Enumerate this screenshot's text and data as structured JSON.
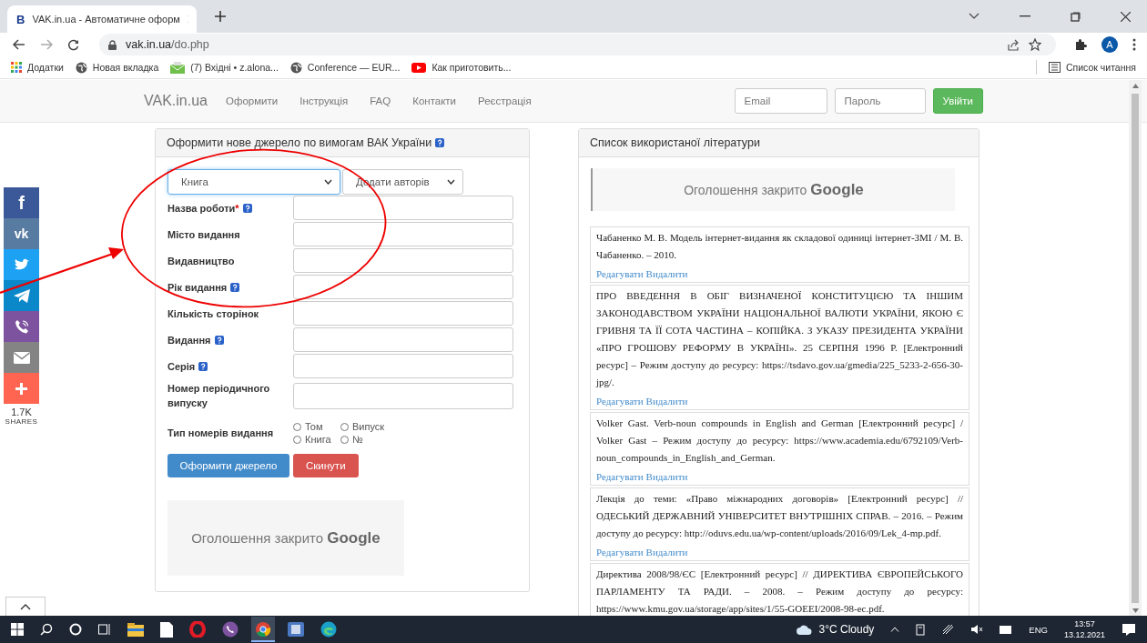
{
  "browser": {
    "tab_title": "VAK.in.ua - Автоматичне оформ",
    "tab_favicon": "B",
    "url_host": "vak.in.ua",
    "url_path": "/do.php",
    "avatar": "A",
    "bookmarks": [
      {
        "kind": "apps",
        "label": "Додатки"
      },
      {
        "kind": "globe",
        "label": "Новая вкладка"
      },
      {
        "kind": "mail",
        "label": "(7) Вхідні • z.alona..."
      },
      {
        "kind": "globe",
        "label": "Conference — EUR..."
      },
      {
        "kind": "youtube",
        "label": "Как приготовить..."
      }
    ],
    "reading_list": "Список читання"
  },
  "nav": {
    "brand": "VAK.in.ua",
    "links": [
      "Оформити",
      "Інструкція",
      "FAQ",
      "Контакти",
      "Реєстрація"
    ],
    "email_placeholder": "Email",
    "password_placeholder": "Пароль",
    "login": "Увійти"
  },
  "form": {
    "title": "Оформити нове джерело по вимогам ВАК України",
    "type_select": "Книга",
    "authors_select": "Додати авторів",
    "fields": [
      {
        "label": "Назва роботи",
        "required_mark": "*",
        "help": true
      },
      {
        "label": "Місто видання",
        "help": false
      },
      {
        "label": "Видавництво",
        "help": false
      },
      {
        "label": "Рік видання",
        "help": true
      },
      {
        "label": "Кількість сторінок",
        "help": false
      },
      {
        "label": "Видання",
        "help": true
      },
      {
        "label": "Серія",
        "help": true
      },
      {
        "label": "Номер періодичного випуску",
        "help": false
      }
    ],
    "number_type_label": "Тип номерів видання",
    "number_types": [
      {
        "label": "Том",
        "selected": false
      },
      {
        "label": "Випуск",
        "selected": false
      },
      {
        "label": "Книга",
        "selected": false
      },
      {
        "label": "№",
        "selected": false
      }
    ],
    "submit": "Оформити джерело",
    "reset": "Скинути",
    "ad": "Оголошення закрито **Google**"
  },
  "list": {
    "title": "Список використаної літератури",
    "ad": "Оголошення закрито **Google**",
    "entries": [
      {
        "text": "Чабаненко М. В. Модель інтернет-видання як складової одиниці інтернет-ЗМІ / М. В. Чабаненко. – 2010.",
        "edit": "Редагувати",
        "delete": "Видалити"
      },
      {
        "text": "ПРО ВВЕДЕННЯ В ОБІГ ВИЗНАЧЕНОЇ КОНСТИТУЦІЄЮ ТА ІНШИМ ЗАКОНОДАВСТВОМ УКРАЇНИ НАЦІОНАЛЬНОЇ ВАЛЮТИ УКРАЇНИ, ЯКОЮ Є ГРИВНЯ ТА ЇЇ СОТА ЧАСТИНА – КОПІЙКА. З УКАЗУ ПРЕЗИДЕНТА УКРАЇНИ «ПРО ГРОШОВУ РЕФОРМУ В УКРАЇНІ». 25 СЕРПНЯ 1996 Р. [Електронний ресурс] – Режим доступу до ресурсу: https://tsdavo.gov.ua/gmedia/225_5233-2-656-30-jpg/.",
        "edit": "Редагувати",
        "delete": "Видалити"
      },
      {
        "text": "Volker Gast. Verb-noun compounds in English and German [Електронний ресурс] / Volker Gast – Режим доступу до ресурсу: https://www.academia.edu/6792109/Verb-noun_compounds_in_English_and_German.",
        "edit": "Редагувати",
        "delete": "Видалити"
      },
      {
        "text": "Лекція до теми: «Право міжнародних договорів» [Електронний ресурс] // ОДЕСЬКИЙ ДЕРЖАВНИЙ УНІВЕРСИТЕТ ВНУТРІШНІХ СПРАВ. – 2016. – Режим доступу до ресурсу: http://oduvs.edu.ua/wp-content/uploads/2016/09/Lek_4-mp.pdf.",
        "edit": "Редагувати",
        "delete": "Видалити"
      },
      {
        "text": "Директива 2008/98/ЄС [Електронний ресурс] // ДИРЕКТИВА ЄВРОПЕЙСЬКОГО ПАРЛАМЕНТУ ТА РАДИ. – 2008. – Режим доступу до ресурсу: https://www.kmu.gov.ua/storage/app/sites/1/55-GOEEI/2008-98-ec.pdf."
      }
    ]
  },
  "share": {
    "items": [
      {
        "kind": "facebook",
        "glyph": "f",
        "color": "#3b5998"
      },
      {
        "kind": "vk",
        "glyph": "vk",
        "color": "#587ba1"
      },
      {
        "kind": "twitter",
        "color": "#1da1f2"
      },
      {
        "kind": "telegram",
        "color": "#0a88c9"
      },
      {
        "kind": "viber",
        "color": "#7d529e"
      },
      {
        "kind": "email",
        "color": "#848484"
      },
      {
        "kind": "more",
        "color": "#ff6550"
      }
    ],
    "count": "1.7K",
    "label": "SHARES"
  },
  "taskbar": {
    "weather": "3°C  Cloudy",
    "lang": "ENG",
    "time": "13:57",
    "date": "13.12.2021"
  }
}
